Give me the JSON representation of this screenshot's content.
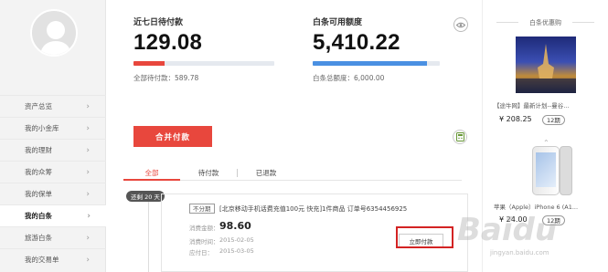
{
  "sidebar": {
    "items": [
      {
        "label": "资产总览"
      },
      {
        "label": "我的小金库"
      },
      {
        "label": "我的理财"
      },
      {
        "label": "我的众筹"
      },
      {
        "label": "我的保单"
      },
      {
        "label": "我的白条",
        "active": true
      },
      {
        "label": "旅游白条"
      },
      {
        "label": "我的交易单"
      }
    ]
  },
  "summary": {
    "pending": {
      "label": "近七日待付款",
      "value": "129.08",
      "total_label": "全部待付款：589.78",
      "progress": 0.22,
      "color": "#e8473d"
    },
    "credit": {
      "label": "白条可用额度",
      "value": "5,410.22",
      "total_label": "白条总额度：6,000.00",
      "progress": 0.9,
      "color": "#4a90e2"
    }
  },
  "actions": {
    "merge_pay": "合并付款"
  },
  "tabs": [
    {
      "label": "全部",
      "active": true
    },
    {
      "label": "待付款"
    },
    {
      "label": "已退款"
    }
  ],
  "timeline": {
    "badge": "还剩 20 天"
  },
  "order": {
    "installment": "不分期",
    "description": "[北京移动手机话费充值100元 快充]1件商品 订单号6354456925",
    "amount_label": "消费金额：",
    "amount": "98.60",
    "time_label": "消费时间：",
    "time": "2015-02-05",
    "due_label": "应付日：",
    "due": "2015-03-05",
    "pay_button": "立即付款"
  },
  "promo": {
    "title": "白条优惠购",
    "products": [
      {
        "title": "【途牛网】最新计划--曼谷...",
        "price": "¥ 208.25",
        "period": "12期"
      },
      {
        "title": "苹果（Apple）iPhone 6 (A1...",
        "price": "¥ 24.00",
        "period": "12期"
      }
    ]
  },
  "watermark": {
    "brand": "Baidu",
    "url": "jingyan.baidu.com"
  }
}
